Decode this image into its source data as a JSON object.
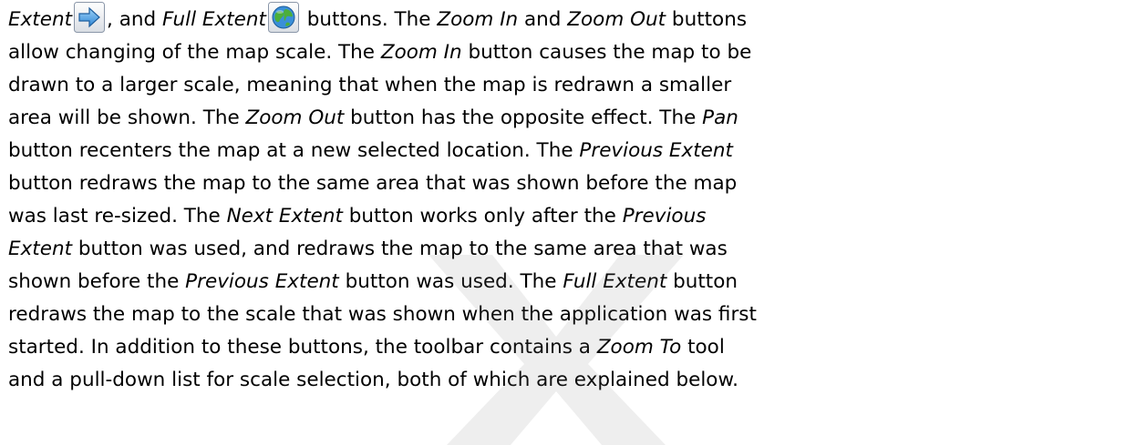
{
  "icons": {
    "next_extent": "blue-right-arrow-icon",
    "full_extent": "globe-icon"
  },
  "paragraph": {
    "l1": {
      "s1": "Extent",
      "s2": ", and ",
      "s3": "Full Extent",
      "s4": " buttons. The ",
      "s5": "Zoom In",
      "s6": " and ",
      "s7": "Zoom Out",
      "s8": " buttons"
    },
    "l2": {
      "s1": "allow changing of the map scale.  The ",
      "s2": "Zoom In",
      "s3": " button causes the map to be"
    },
    "l3": {
      "s1": "drawn to a larger scale, meaning that when the map is redrawn a smaller"
    },
    "l4": {
      "s1": "area will be shown.  The ",
      "s2": "Zoom Out",
      "s3": " button has the opposite effect.  The ",
      "s4": "Pan"
    },
    "l5": {
      "s1": "button recenters the map at a new selected location.  The ",
      "s2": "Previous Extent"
    },
    "l6": {
      "s1": "button redraws the map to the same area that was shown before the map"
    },
    "l7": {
      "s1": "was last re-sized.  The ",
      "s2": "Next Extent",
      "s3": " button works only after the ",
      "s4": "Previous"
    },
    "l8": {
      "s1": "Extent",
      "s2": " button was used, and redraws the map to the same area that was"
    },
    "l9": {
      "s1": "shown before the ",
      "s2": "Previous Extent",
      "s3": " button was used. The ",
      "s4": "Full Extent",
      "s5": " button"
    },
    "l10": {
      "s1": "redraws the map to the scale that was shown when the application was first"
    },
    "l11": {
      "s1": "started.  In addition to these buttons, the toolbar contains a ",
      "s2": "Zoom To",
      "s3": " tool"
    },
    "l12": {
      "s1": "and a pull-down list for scale selection, both of which are explained below."
    }
  }
}
